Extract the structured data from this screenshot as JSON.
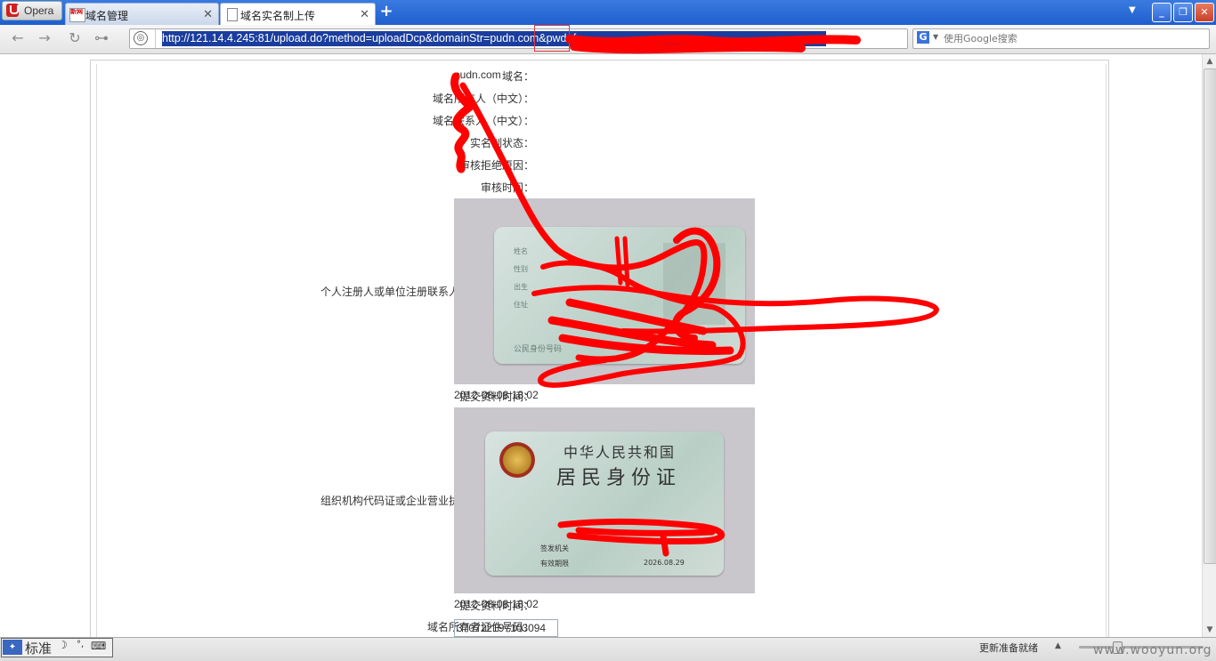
{
  "browser": {
    "menu_label": "Opera",
    "tabs": [
      {
        "title": "域名管理",
        "favicon_text": "新网"
      },
      {
        "title": "域名实名制上传"
      }
    ],
    "new_tab_label": "+",
    "url": "http://121.14.4.245:81/upload.do?method=uploadDcp&domainStr=pudn.com&pwd=f",
    "search_placeholder": "使用Google搜索",
    "search_engine_icon": "G"
  },
  "page": {
    "fields": [
      {
        "label": "域名：",
        "value": "pudn.com"
      },
      {
        "label": "域名所有人（中文）：",
        "value": ""
      },
      {
        "label": "域名联系人（中文）：",
        "value": ""
      },
      {
        "label": "实名制状态：",
        "value": ""
      },
      {
        "label": "审核拒绝原因：",
        "value": ""
      },
      {
        "label": "审核时间：",
        "value": ""
      }
    ],
    "scan1": {
      "label": "个人注册人或单位注册联系人身份证扫描件：",
      "card_labels": [
        "姓名",
        "性别",
        "出生",
        "住址",
        "公民身份号码"
      ],
      "submit_label": "提交资料时间：",
      "submit_time": "2012-08-08 18:02"
    },
    "scan2": {
      "label": "组织机构代码证或企业营业执照副本扫描件：",
      "card_title1": "中华人民共和国",
      "card_title2": "居民身份证",
      "issuer_label": "签发机关",
      "valid_label": "有效期限",
      "valid_date": "2026.08.29",
      "submit_label": "提交资料时间：",
      "submit_time": "2012-08-08 18:02"
    },
    "id_number": {
      "label": "域名所有者证件号码：",
      "value": "370722197103094"
    }
  },
  "status_bar": {
    "ime_mode": "标准",
    "status_text": "更新准备就绪",
    "watermark": "www.wooyun.org"
  },
  "colors": {
    "redaction": "#ff0000",
    "title_bar": "#2a6ad8",
    "url_highlight": "#1a3d9e"
  }
}
